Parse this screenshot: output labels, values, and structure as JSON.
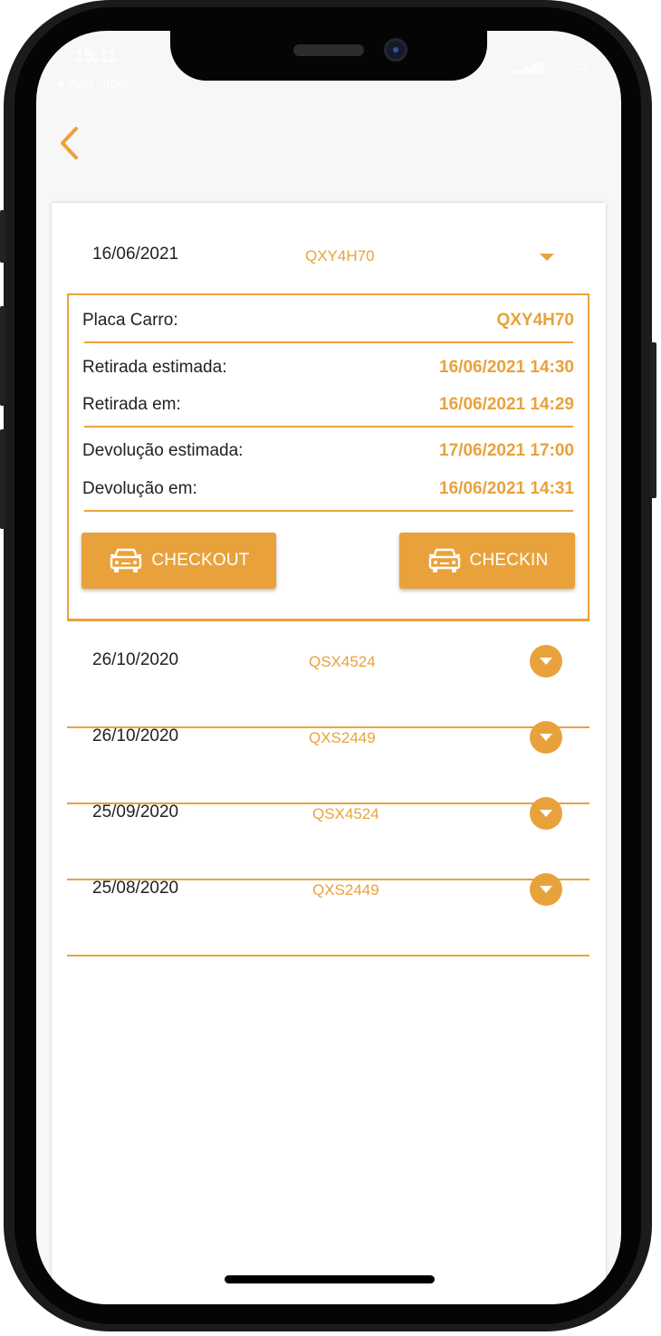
{
  "status_bar": {
    "time": "15:11",
    "back_label": "◄ App Store"
  },
  "colors": {
    "accent": "#e9a23b",
    "text": "#222222",
    "background": "#f7f7f7"
  },
  "nav": {
    "back_icon": "chevron-left-icon"
  },
  "expanded": {
    "date": "16/06/2021",
    "plate": "QXY4H70",
    "details": [
      {
        "label": "Placa Carro:",
        "value": "QXY4H70"
      },
      {
        "label": "Retirada estimada:",
        "value": "16/06/2021 14:30"
      },
      {
        "label": "Retirada em:",
        "value": "16/06/2021 14:29"
      },
      {
        "label": "Devolução estimada:",
        "value": "17/06/2021 17:00"
      },
      {
        "label": "Devolução em:",
        "value": "16/06/2021 14:31"
      }
    ],
    "checkout_label": "CHECKOUT",
    "checkin_label": "CHECKIN",
    "button_icon": "car-icon"
  },
  "rentals": [
    {
      "date": "26/10/2020",
      "plate": "QSX4524"
    },
    {
      "date": "26/10/2020",
      "plate": "QXS2449"
    },
    {
      "date": "25/09/2020",
      "plate": "QSX4524"
    },
    {
      "date": "25/08/2020",
      "plate": "QXS2449"
    }
  ]
}
